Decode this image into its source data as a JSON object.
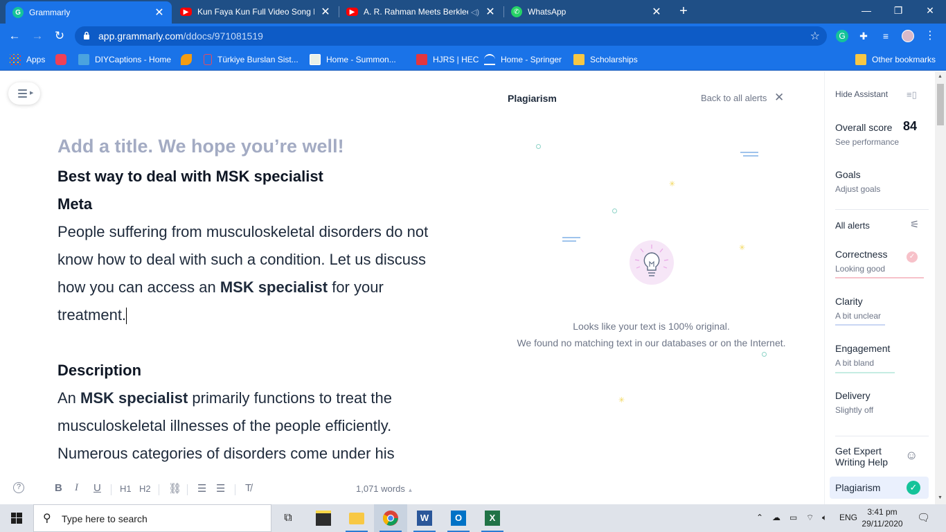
{
  "browser": {
    "tabs": [
      {
        "title": "Grammarly",
        "active": true
      },
      {
        "title": "Kun Faya Kun Full Video Song Ro"
      },
      {
        "title": "A. R. Rahman Meets Berklee"
      },
      {
        "title": "WhatsApp"
      }
    ],
    "url_host": "app.grammarly.com",
    "url_path": "/ddocs/971081519",
    "bookmarks": [
      "Apps",
      "DIYCaptions - Home",
      "Türkiye Burslan Sist...",
      "Home - Summon...",
      "HJRS | HEC",
      "Home - Springer",
      "Scholarships",
      "Other bookmarks"
    ]
  },
  "document": {
    "title_placeholder": "Add a title. We hope you’re well!",
    "heading1": "Best way to deal with MSK specialist",
    "heading2": "Meta",
    "meta_para_a": "People suffering from musculoskeletal disorders do not know how to deal with such a condition. Let us discuss how you can access an ",
    "meta_para_bold": "MSK specialist",
    "meta_para_b": " for your treatment.",
    "heading3": "Description",
    "desc_para_a": "An ",
    "desc_para_bold": "MSK specialist",
    "desc_para_b": " primarily functions to treat the musculoskeletal illnesses of the people efficiently. Numerous categories of disorders come under his"
  },
  "toolbar": {
    "bold": "B",
    "italic": "I",
    "underline": "U",
    "h1": "H1",
    "h2": "H2",
    "word_count": "1,071 words"
  },
  "plagiarism": {
    "title": "Plagiarism",
    "back_link": "Back to all alerts",
    "message_line1": "Looks like your text is 100% original.",
    "message_line2": "We found no matching text in our databases or on the Internet."
  },
  "assistant": {
    "hide_label": "Hide Assistant",
    "overall_score_label": "Overall score",
    "overall_score": "84",
    "see_performance": "See performance",
    "goals": "Goals",
    "adjust_goals": "Adjust goals",
    "all_alerts": "All alerts",
    "categories": [
      {
        "name": "Correctness",
        "status": "Looking good",
        "color": "#f7c1c9"
      },
      {
        "name": "Clarity",
        "status": "A bit unclear",
        "color": "#c9d6f3"
      },
      {
        "name": "Engagement",
        "status": "A bit bland",
        "color": "#c5ece2"
      },
      {
        "name": "Delivery",
        "status": "Slightly off",
        "color": "#e9ddf5"
      }
    ],
    "expert_help": "Get Expert Writing Help",
    "plagiarism": "Plagiarism"
  },
  "taskbar": {
    "search_placeholder": "Type here to search",
    "language": "ENG",
    "time": "3:41 pm",
    "date": "29/11/2020"
  },
  "colors": {
    "chrome_blue": "#1a73e8",
    "grammarly_green": "#15c39a",
    "title_placeholder": "#a3abc3"
  }
}
